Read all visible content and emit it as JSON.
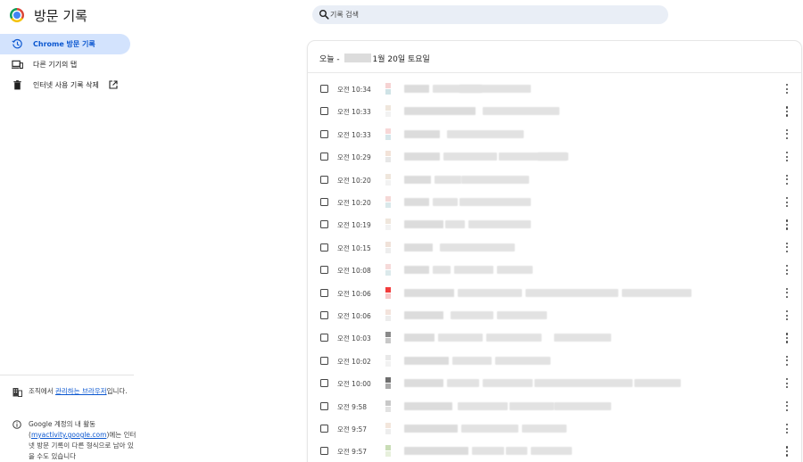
{
  "header": {
    "title": "방문 기록",
    "search_placeholder": "기록 검색"
  },
  "sidebar": {
    "items": [
      {
        "label": "Chrome 방문 기록",
        "icon": "history-icon",
        "active": true
      },
      {
        "label": "다른 기기의 탭",
        "icon": "devices-icon",
        "active": false
      },
      {
        "label": "인터넷 사용 기록 삭제",
        "icon": "trash-icon",
        "active": false
      }
    ],
    "managed": {
      "prefix": "조직에서 ",
      "link": "관리하는 브라우저",
      "suffix": "입니다."
    },
    "activity": {
      "prefix": "Google 계정의 내 활동 (",
      "link": "myactivity.google.com",
      "suffix": ")에는 인터넷 방문 기록이 다른 형식으로 남아 있을 수도 있습니다"
    }
  },
  "history": {
    "date_prefix": "오늘 - ",
    "date_suffix": "1월 20일 토요일",
    "entries": [
      {
        "time": "오전 10:34"
      },
      {
        "time": "오전 10:33"
      },
      {
        "time": "오전 10:33"
      },
      {
        "time": "오전 10:29"
      },
      {
        "time": "오전 10:20"
      },
      {
        "time": "오전 10:20"
      },
      {
        "time": "오전 10:19"
      },
      {
        "time": "오전 10:15"
      },
      {
        "time": "오전 10:08"
      },
      {
        "time": "오전 10:06"
      },
      {
        "time": "오전 10:06"
      },
      {
        "time": "오전 10:03"
      },
      {
        "time": "오전 10:02"
      },
      {
        "time": "오전 10:00"
      },
      {
        "time": "오전 9:58"
      },
      {
        "time": "오전 9:57"
      },
      {
        "time": "오전 9:57"
      }
    ]
  },
  "colors": {
    "accent": "#0b57d0",
    "active_bg": "#d3e3fd",
    "search_bg": "#e9eef6"
  }
}
